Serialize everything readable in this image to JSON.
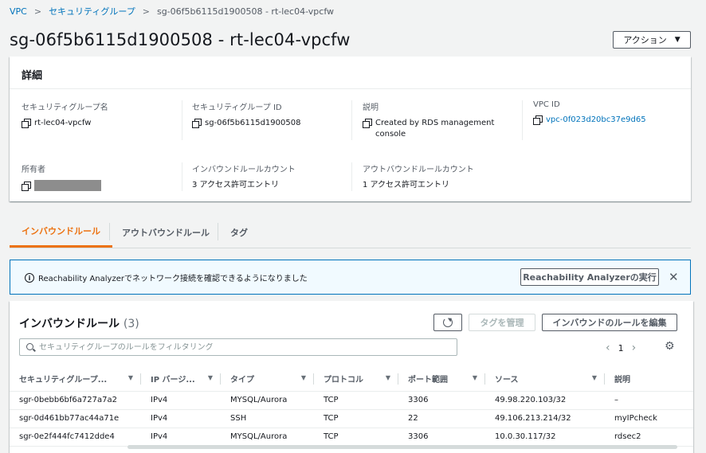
{
  "breadcrumb": {
    "items": [
      "VPC",
      "セキュリティグループ",
      "sg-06f5b6115d1900508 - rt-lec04-vpcfw"
    ]
  },
  "page_title": "sg-06f5b6115d1900508 - rt-lec04-vpcfw",
  "actions_label": "アクション",
  "details": {
    "heading": "詳細",
    "fields": {
      "sg_name": {
        "label": "セキュリティグループ名",
        "value": "rt-lec04-vpcfw"
      },
      "sg_id": {
        "label": "セキュリティグループ ID",
        "value": "sg-06f5b6115d1900508"
      },
      "description": {
        "label": "説明",
        "value": "Created by RDS management console"
      },
      "vpc_id": {
        "label": "VPC ID",
        "value": "vpc-0f023d20bc37e9d65"
      },
      "owner": {
        "label": "所有者",
        "value": ""
      },
      "inbound_count": {
        "label": "インバウンドルールカウント",
        "value": "3 アクセス許可エントリ"
      },
      "outbound_count": {
        "label": "アウトバウンドルールカウント",
        "value": "1 アクセス許可エントリ"
      }
    }
  },
  "tabs": [
    "インバウンドルール",
    "アウトバウンドルール",
    "タグ"
  ],
  "flash": {
    "message": "Reachability Analyzerでネットワーク接続を確認できるようになりました",
    "button": "Reachability Analyzerの実行"
  },
  "rules": {
    "title": "インバウンドルール",
    "count": "(3)",
    "manage_tags": "タグを管理",
    "edit_rules": "インバウンドのルールを編集",
    "search_placeholder": "セキュリティグループのルールをフィルタリング",
    "page": "1",
    "columns": [
      "セキュリティグループ...",
      "IP バージ...",
      "タイプ",
      "プロトコル",
      "ポート範囲",
      "ソース",
      "説明"
    ],
    "rows": [
      [
        "sgr-0bebb6bf6a727a7a2",
        "IPv4",
        "MYSQL/Aurora",
        "TCP",
        "3306",
        "49.98.220.103/32",
        "–"
      ],
      [
        "sgr-0d461bb77ac44a71e",
        "IPv4",
        "SSH",
        "TCP",
        "22",
        "49.106.213.214/32",
        "myIPcheck"
      ],
      [
        "sgr-0e2f444fc7412dde4",
        "IPv4",
        "MYSQL/Aurora",
        "TCP",
        "3306",
        "10.0.30.117/32",
        "rdsec2"
      ]
    ]
  },
  "colors": {
    "accent": "#ec7211",
    "link": "#0073bb",
    "info_bg": "#f1faff"
  },
  "icons": [
    "copy-icon",
    "info-icon",
    "close-icon",
    "refresh-icon",
    "search-icon",
    "gear-icon",
    "caret-down-icon",
    "sort-icon"
  ]
}
